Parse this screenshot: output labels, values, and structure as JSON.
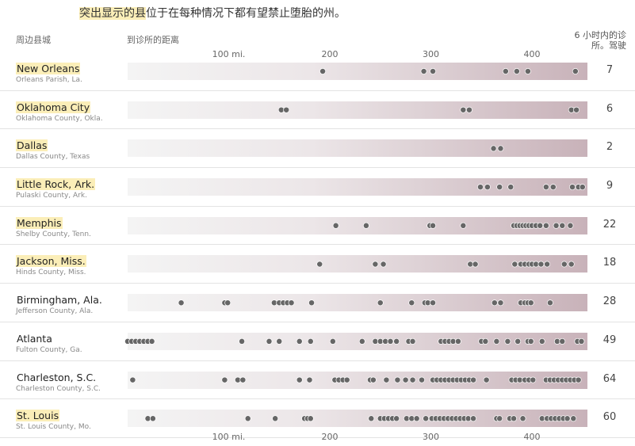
{
  "title": {
    "highlight": "突出显示的县",
    "rest": "位于在每种情况下都有望禁止堕胎的州。"
  },
  "headers": {
    "city": "周边县城",
    "distance": "到诊所的距离",
    "clinics": "6 小时内的诊所。驾驶"
  },
  "colors": {
    "highlight": "#fbeeb8",
    "dot": "#666666",
    "bar_start": "#f4f4f4",
    "bar_end": "#c8b2b9"
  },
  "chart_data": {
    "type": "scatter",
    "title": "",
    "xlabel": "到诊所的距离",
    "ylabel": "周边县城",
    "xlim": [
      0,
      455
    ],
    "x_ticks": [
      {
        "value": 100,
        "label": "100 mi."
      },
      {
        "value": 200,
        "label": "200"
      },
      {
        "value": 300,
        "label": "300"
      },
      {
        "value": 400,
        "label": "400"
      }
    ],
    "grid": false,
    "series": [
      {
        "name": "New Orleans",
        "county": "Orleans Parish, La.",
        "highlighted": true,
        "count": "7",
        "values": [
          193,
          293,
          302,
          374,
          385,
          396,
          443
        ]
      },
      {
        "name": "Oklahoma City",
        "county": "Oklahoma County, Okla.",
        "highlighted": true,
        "count": "6",
        "values": [
          152,
          157,
          332,
          338,
          439,
          444
        ]
      },
      {
        "name": "Dallas",
        "county": "Dallas County, Texas",
        "highlighted": true,
        "count": "2",
        "values": [
          362,
          369
        ]
      },
      {
        "name": "Little Rock, Ark.",
        "county": "Pulaski County, Ark.",
        "highlighted": true,
        "count": "9",
        "values": [
          349,
          356,
          368,
          379,
          414,
          421,
          440,
          446,
          450
        ]
      },
      {
        "name": "Memphis",
        "county": "Shelby County, Tenn.",
        "highlighted": true,
        "count": "22",
        "values": [
          206,
          236,
          299,
          302,
          332,
          382,
          385,
          388,
          391,
          394,
          397,
          400,
          404,
          408,
          414,
          424,
          430,
          438
        ]
      },
      {
        "name": "Jackson, Miss.",
        "county": "Hinds County, Miss.",
        "highlighted": true,
        "count": "18",
        "values": [
          190,
          245,
          253,
          339,
          344,
          383,
          389,
          393,
          397,
          400,
          404,
          409,
          415,
          432,
          439
        ]
      },
      {
        "name": "Birmingham, Ala.",
        "county": "Jefferson County, Ala.",
        "highlighted": false,
        "count": "28",
        "values": [
          53,
          96,
          99,
          145,
          150,
          154,
          158,
          162,
          182,
          250,
          281,
          294,
          297,
          302,
          363,
          369,
          389,
          393,
          396,
          399,
          418
        ]
      },
      {
        "name": "Atlanta",
        "county": "Fulton County, Ga.",
        "highlighted": false,
        "count": "49",
        "values": [
          0,
          4,
          8,
          12,
          16,
          20,
          24,
          113,
          140,
          150,
          170,
          181,
          203,
          232,
          245,
          250,
          255,
          260,
          266,
          278,
          282,
          310,
          314,
          318,
          322,
          327,
          350,
          354,
          365,
          376,
          386,
          396,
          399,
          410,
          425,
          430,
          445,
          449
        ]
      },
      {
        "name": "Charleston, S.C.",
        "county": "Charleston County, S.C.",
        "highlighted": false,
        "count": "64",
        "values": [
          5,
          96,
          109,
          114,
          170,
          180,
          205,
          209,
          213,
          217,
          240,
          243,
          256,
          267,
          275,
          282,
          291,
          302,
          306,
          310,
          314,
          318,
          322,
          326,
          330,
          334,
          338,
          342,
          355,
          380,
          384,
          388,
          393,
          397,
          401,
          414,
          418,
          422,
          426,
          430,
          434,
          438,
          442,
          446
        ]
      },
      {
        "name": "St. Louis",
        "county": "St. Louis County, Mo.",
        "highlighted": true,
        "count": "60",
        "values": [
          20,
          25,
          119,
          146,
          175,
          178,
          181,
          241,
          250,
          254,
          258,
          262,
          266,
          276,
          281,
          286,
          295,
          301,
          305,
          309,
          313,
          317,
          321,
          325,
          329,
          333,
          337,
          342,
          365,
          368,
          378,
          382,
          391,
          410,
          415,
          419,
          423,
          427,
          431,
          435,
          441
        ]
      }
    ]
  }
}
